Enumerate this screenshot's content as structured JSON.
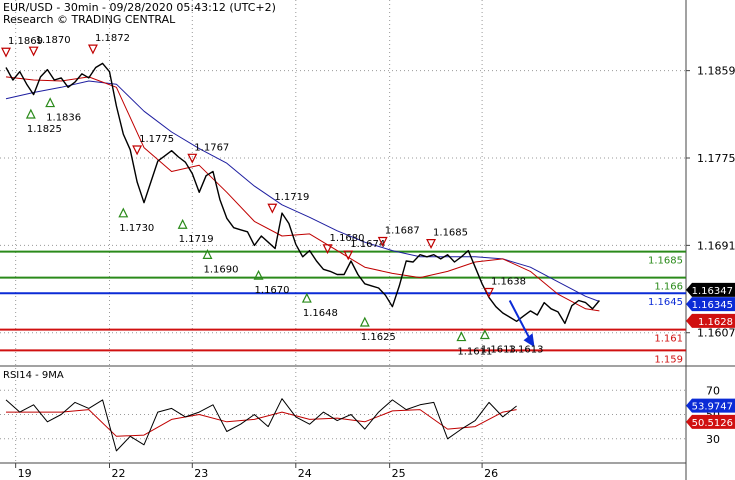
{
  "header": {
    "title": "EUR/USD - 30min - 09/28/2020 05:43:12 (UTC+2)",
    "research": "Research © TRADING CENTRAL"
  },
  "colors": {
    "price": "#000000",
    "ma_fast": "#c00000",
    "ma_slow": "#1e1ea0",
    "resistance": "#2a8a1a",
    "pivot": "#0b2bd6",
    "support": "#d01010",
    "marker_up": "#2a8a1a",
    "marker_down": "#c00000",
    "arrow": "#0b2bd6",
    "rsi": "#000000",
    "rsi_ma": "#c00000",
    "axis_box_black": "#000000",
    "axis_box_blue": "#0b2bd6",
    "axis_box_red": "#d01010"
  },
  "chart_data": [
    {
      "type": "line",
      "name": "price",
      "ylim": [
        1.1575,
        1.19
      ],
      "y_ticks": [
        "1.1859",
        "1.1775",
        "1.1691",
        "1.1607"
      ],
      "x_ticks": [
        "19",
        "22",
        "23",
        "24",
        "25",
        "26"
      ],
      "x_tick_positions": [
        0.7,
        7.5,
        13.5,
        21.0,
        27.8,
        34.5
      ],
      "series": [
        {
          "name": "price",
          "x": [
            0,
            0.5,
            1,
            1.5,
            2,
            2.5,
            3,
            3.5,
            4,
            4.5,
            5,
            5.5,
            6,
            6.5,
            7,
            7.5,
            8,
            8.5,
            9,
            9.5,
            10,
            10.5,
            11,
            11.5,
            12,
            12.5,
            13,
            13.5,
            14,
            14.5,
            15,
            15.5,
            16,
            16.5,
            17,
            17.5,
            18,
            18.5,
            19,
            19.5,
            20,
            20.5,
            21,
            21.5,
            22,
            22.5,
            23,
            23.5,
            24,
            24.5,
            25,
            25.5,
            26,
            26.5,
            27,
            27.5,
            28,
            28.5,
            29,
            29.5,
            30,
            30.5,
            31,
            31.5,
            32,
            32.5,
            33,
            33.5,
            34,
            34.5,
            35,
            35.5,
            36,
            36.5,
            37,
            37.5,
            38,
            38.5,
            39,
            39.5,
            40,
            40.5,
            41,
            41.5,
            42,
            42.5,
            43
          ],
          "values": [
            1.1862,
            1.185,
            1.1858,
            1.1846,
            1.1836,
            1.1853,
            1.186,
            1.185,
            1.1852,
            1.1843,
            1.1848,
            1.1856,
            1.1852,
            1.1862,
            1.1866,
            1.1858,
            1.1825,
            1.1798,
            1.1783,
            1.1752,
            1.1732,
            1.1752,
            1.1772,
            1.1777,
            1.1782,
            1.1776,
            1.1771,
            1.176,
            1.1742,
            1.1758,
            1.1762,
            1.1735,
            1.1717,
            1.1708,
            1.1706,
            1.1704,
            1.1691,
            1.17,
            1.1694,
            1.1688,
            1.1722,
            1.1712,
            1.1692,
            1.168,
            1.1686,
            1.1676,
            1.1668,
            1.1666,
            1.1663,
            1.1663,
            1.1676,
            1.1663,
            1.1654,
            1.1652,
            1.165,
            1.1643,
            1.1632,
            1.1652,
            1.1676,
            1.1675,
            1.1682,
            1.168,
            1.1682,
            1.1678,
            1.1682,
            1.1675,
            1.168,
            1.1686,
            1.167,
            1.1654,
            1.1641,
            1.1632,
            1.1626,
            1.1622,
            1.1618,
            1.1623,
            1.1628,
            1.1624,
            1.1636,
            1.163,
            1.1627,
            1.1616,
            1.1633,
            1.1638,
            1.1636,
            1.163,
            1.1638
          ]
        },
        {
          "name": "ma-fast",
          "x": [
            0,
            2,
            4,
            6,
            8,
            10,
            12,
            14,
            16,
            18,
            20,
            22,
            24,
            26,
            28,
            30,
            32,
            34,
            36,
            38,
            40,
            42,
            43
          ],
          "values": [
            1.1853,
            1.185,
            1.1849,
            1.1853,
            1.1843,
            1.1785,
            1.1762,
            1.1768,
            1.1742,
            1.1714,
            1.17,
            1.1702,
            1.1686,
            1.167,
            1.1664,
            1.166,
            1.1666,
            1.1675,
            1.1678,
            1.1666,
            1.1644,
            1.163,
            1.1628
          ]
        },
        {
          "name": "ma-slow",
          "x": [
            0,
            2,
            4,
            6,
            8,
            10,
            12,
            14,
            16,
            18,
            20,
            22,
            24,
            26,
            28,
            30,
            32,
            34,
            36,
            38,
            40,
            42,
            43
          ],
          "values": [
            1.1832,
            1.1838,
            1.1843,
            1.1849,
            1.1846,
            1.182,
            1.18,
            1.1784,
            1.177,
            1.1748,
            1.173,
            1.1718,
            1.1705,
            1.1694,
            1.1686,
            1.168,
            1.168,
            1.168,
            1.1678,
            1.167,
            1.1656,
            1.1642,
            1.1637
          ]
        }
      ],
      "horizontal_levels": [
        {
          "value": 1.1685,
          "label": "1.1685",
          "color": "#2a8a1a"
        },
        {
          "value": 1.166,
          "label": "1.166",
          "color": "#2a8a1a"
        },
        {
          "value": 1.1645,
          "label": "1.1645",
          "color": "#0b2bd6"
        },
        {
          "value": 1.161,
          "label": "1.161",
          "color": "#d01010"
        },
        {
          "value": 1.159,
          "label": "1.159",
          "color": "#d01010"
        }
      ],
      "axis_boxes": [
        {
          "value": 1.16347,
          "label": "1.16347",
          "color": "#000000"
        },
        {
          "value": 1.16345,
          "label": "1.16345",
          "color": "#0b2bd6"
        },
        {
          "value": 1.1628,
          "label": "1.1628",
          "color": "#d01010"
        }
      ],
      "swing_points": [
        {
          "x": 0.0,
          "value": 1.1869,
          "label": "1.1869",
          "kind": "high"
        },
        {
          "x": 2.0,
          "value": 1.187,
          "label": "1.1870",
          "kind": "high"
        },
        {
          "x": 6.3,
          "value": 1.1872,
          "label": "1.1872",
          "kind": "high"
        },
        {
          "x": 1.8,
          "value": 1.1825,
          "label": "1.1825",
          "kind": "low"
        },
        {
          "x": 3.2,
          "value": 1.1836,
          "label": "1.1836",
          "kind": "low"
        },
        {
          "x": 9.5,
          "value": 1.1775,
          "label": "1.1775",
          "kind": "high"
        },
        {
          "x": 13.5,
          "value": 1.1767,
          "label": "1.1767",
          "kind": "high"
        },
        {
          "x": 8.5,
          "value": 1.173,
          "label": "1.1730",
          "kind": "low"
        },
        {
          "x": 12.8,
          "value": 1.1719,
          "label": "1.1719",
          "kind": "low"
        },
        {
          "x": 19.3,
          "value": 1.1719,
          "label": "1.1719",
          "kind": "high"
        },
        {
          "x": 14.6,
          "value": 1.169,
          "label": "1.1690",
          "kind": "low"
        },
        {
          "x": 18.3,
          "value": 1.167,
          "label": "1.1670",
          "kind": "low"
        },
        {
          "x": 23.3,
          "value": 1.168,
          "label": "1.1680",
          "kind": "high"
        },
        {
          "x": 24.8,
          "value": 1.1674,
          "label": "1.1674",
          "kind": "high"
        },
        {
          "x": 21.8,
          "value": 1.1648,
          "label": "1.1648",
          "kind": "low"
        },
        {
          "x": 27.3,
          "value": 1.1687,
          "label": "1.1687",
          "kind": "high"
        },
        {
          "x": 30.8,
          "value": 1.1685,
          "label": "1.1685",
          "kind": "high"
        },
        {
          "x": 26.0,
          "value": 1.1625,
          "label": "1.1625",
          "kind": "low"
        },
        {
          "x": 35.0,
          "value": 1.1638,
          "label": "1.1638",
          "kind": "high"
        },
        {
          "x": 33.0,
          "value": 1.1611,
          "label": "1.1611",
          "kind": "low"
        },
        {
          "x": 34.7,
          "value": 1.1613,
          "label": "1.1613",
          "kind": "low"
        },
        {
          "x": 36.7,
          "value": 1.1613,
          "label": "1.1613",
          "kind": "none"
        }
      ],
      "forecast_arrow": {
        "from": {
          "x": 36.5,
          "value": 1.1638
        },
        "to": {
          "x": 38.3,
          "value": 1.1593
        }
      }
    },
    {
      "type": "line",
      "title": "RSI14 - 9MA",
      "ylim": [
        10,
        90
      ],
      "y_ticks": [
        "70",
        "50",
        "30"
      ],
      "series": [
        {
          "name": "RSI14",
          "x": [
            0,
            1,
            2,
            3,
            4,
            5,
            6,
            7,
            8,
            9,
            10,
            11,
            12,
            13,
            14,
            15,
            16,
            17,
            18,
            19,
            20,
            21,
            22,
            23,
            24,
            25,
            26,
            27,
            28,
            29,
            30,
            31,
            32,
            33,
            34,
            35,
            36,
            37
          ],
          "values": [
            62,
            52,
            58,
            44,
            50,
            60,
            55,
            62,
            20,
            32,
            25,
            52,
            55,
            48,
            52,
            58,
            36,
            42,
            50,
            40,
            63,
            48,
            42,
            52,
            45,
            50,
            38,
            52,
            62,
            54,
            58,
            60,
            30,
            38,
            45,
            60,
            48,
            57
          ]
        },
        {
          "name": "9MA",
          "x": [
            0,
            2,
            4,
            6,
            8,
            10,
            12,
            14,
            16,
            18,
            20,
            22,
            24,
            26,
            28,
            30,
            32,
            34,
            36,
            37
          ],
          "values": [
            52,
            52,
            52,
            54,
            32,
            33,
            46,
            50,
            44,
            46,
            52,
            46,
            47,
            44,
            53,
            54,
            38,
            40,
            52,
            54
          ]
        }
      ],
      "axis_boxes": [
        {
          "value": 53.9747,
          "label": "53.9747",
          "color": "#0b2bd6"
        },
        {
          "value": 50.5126,
          "label": "50.5126",
          "color": "#d01010"
        }
      ]
    }
  ]
}
